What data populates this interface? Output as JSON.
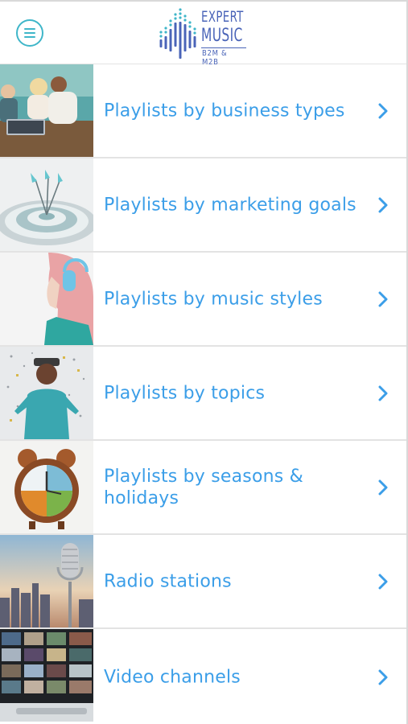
{
  "header": {
    "menu_icon": "hamburger-menu-icon",
    "accent_color": "#3fb6c9",
    "logo": {
      "line1": "EXPERT",
      "line2": "MUSIC",
      "tagline": "B2M & M2B",
      "color": "#4a64b8"
    }
  },
  "list": {
    "text_color": "#3b9ee8",
    "chevron_icon": "chevron-right-icon",
    "items": [
      {
        "label": "Playlists by business types",
        "thumbnail": "friends-with-laptop-photo"
      },
      {
        "label": "Playlists by marketing goals",
        "thumbnail": "target-with-arrows-photo"
      },
      {
        "label": "Playlists by music styles",
        "thumbnail": "woman-with-headphones-photo"
      },
      {
        "label": "Playlists by topics",
        "thumbnail": "man-with-confetti-photo"
      },
      {
        "label": "Playlists by seasons & holidays",
        "thumbnail": "seasons-alarm-clock-photo"
      },
      {
        "label": "Radio stations",
        "thumbnail": "microphone-city-photo"
      },
      {
        "label": "Video channels",
        "thumbnail": "tv-screens-wall-photo"
      }
    ]
  }
}
